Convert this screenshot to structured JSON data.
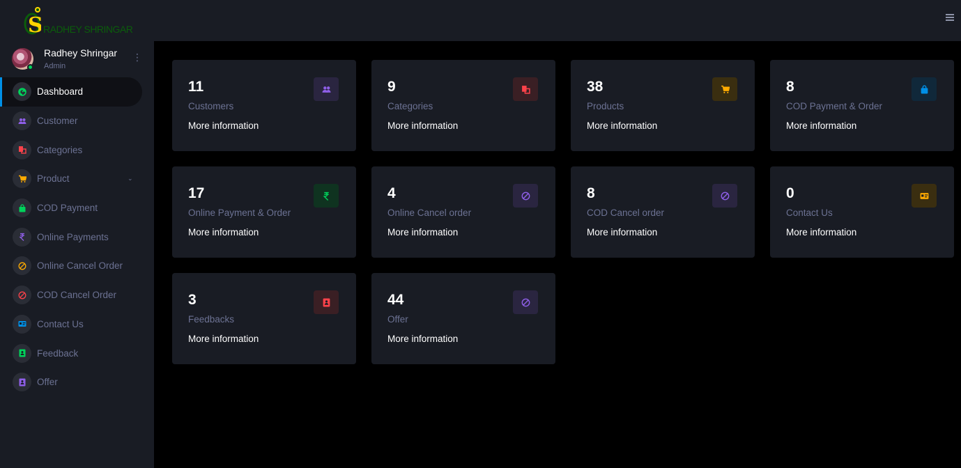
{
  "brand": {
    "logo_text": "RADHEY SHRINGAR"
  },
  "profile": {
    "name": "Radhey Shringar",
    "role": "Admin"
  },
  "sidebar": {
    "items": [
      {
        "label": "Dashboard",
        "icon": "speedometer-icon",
        "color": "#00d25b",
        "active": true
      },
      {
        "label": "Customer",
        "icon": "users-icon",
        "color": "#8f5fe8"
      },
      {
        "label": "Categories",
        "icon": "categories-icon",
        "color": "#fc424a"
      },
      {
        "label": "Product",
        "icon": "cart-icon",
        "color": "#ffab00",
        "has_submenu": true
      },
      {
        "label": "COD Payment",
        "icon": "bag-icon",
        "color": "#00d25b"
      },
      {
        "label": "Online Payments",
        "icon": "rupee-icon",
        "color": "#8f5fe8"
      },
      {
        "label": "Online Cancel Order",
        "icon": "cancel-icon",
        "color": "#ffab00"
      },
      {
        "label": "COD Cancel Order",
        "icon": "cancel-icon",
        "color": "#fc424a"
      },
      {
        "label": "Contact Us",
        "icon": "contact-card-icon",
        "color": "#0090e7"
      },
      {
        "label": "Feedback",
        "icon": "feedback-icon",
        "color": "#00d25b"
      },
      {
        "label": "Offer",
        "icon": "offer-icon",
        "color": "#8f5fe8"
      }
    ]
  },
  "cards": [
    {
      "count": "11",
      "label": "Customers",
      "more": "More information",
      "icon": "users-icon",
      "color": "#8f5fe8",
      "bg": "#2a2540"
    },
    {
      "count": "9",
      "label": "Categories",
      "more": "More information",
      "icon": "categories-icon",
      "color": "#fc424a",
      "bg": "#3a1f24"
    },
    {
      "count": "38",
      "label": "Products",
      "more": "More information",
      "icon": "cart-icon",
      "color": "#ffab00",
      "bg": "#3a2e10"
    },
    {
      "count": "8",
      "label": "COD Payment & Order",
      "more": "More information",
      "icon": "bag-icon",
      "color": "#0090e7",
      "bg": "#10283a"
    },
    {
      "count": "17",
      "label": "Online Payment & Order",
      "more": "More information",
      "icon": "rupee-icon",
      "color": "#00d25b",
      "bg": "#0f3320"
    },
    {
      "count": "4",
      "label": "Online Cancel order",
      "more": "More information",
      "icon": "cancel-icon",
      "color": "#8f5fe8",
      "bg": "#2a2540"
    },
    {
      "count": "8",
      "label": "COD Cancel order",
      "more": "More information",
      "icon": "cancel-icon",
      "color": "#8f5fe8",
      "bg": "#2a2540"
    },
    {
      "count": "0",
      "label": "Contact Us",
      "more": "More information",
      "icon": "contact-card-icon",
      "color": "#ffab00",
      "bg": "#3a2e10"
    },
    {
      "count": "3",
      "label": "Feedbacks",
      "more": "More information",
      "icon": "feedback-icon",
      "color": "#fc424a",
      "bg": "#3a1f24"
    },
    {
      "count": "44",
      "label": "Offer",
      "more": "More information",
      "icon": "cancel-icon",
      "color": "#8f5fe8",
      "bg": "#2a2540"
    }
  ]
}
